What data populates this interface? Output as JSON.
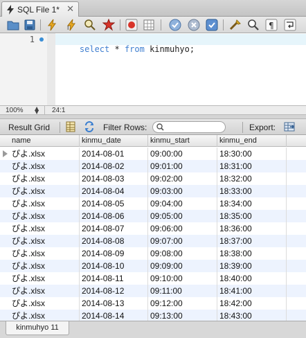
{
  "tab": {
    "label": "SQL File 1*",
    "close_glyph": "✕",
    "icon": "lightning-icon"
  },
  "toolbar": {
    "icons": [
      "open-folder-icon",
      "save-icon",
      "execute-icon",
      "execute-current-icon",
      "explain-icon",
      "stop-icon",
      "toggle-error-stop-icon",
      "toggle-limit-icon",
      "commit-icon",
      "rollback-icon",
      "autocommit-icon",
      "beautify-icon",
      "find-icon",
      "invisible-chars-icon",
      "wrap-icon"
    ]
  },
  "editor": {
    "line_number": "1",
    "tokens": [
      {
        "text": "select",
        "kind": "kw"
      },
      {
        "text": " * ",
        "kind": "plain"
      },
      {
        "text": "from",
        "kind": "kw"
      },
      {
        "text": " kinmuhyo;",
        "kind": "plain"
      }
    ]
  },
  "status": {
    "zoom": "100%",
    "cursor": "24:1"
  },
  "result_toolbar": {
    "result_grid_label": "Result Grid",
    "filter_label": "Filter Rows:",
    "filter_value": "",
    "export_label": "Export:"
  },
  "grid": {
    "columns": [
      "name",
      "kinmu_date",
      "kinmu_start",
      "kinmu_end"
    ],
    "rows": [
      [
        "ぴよ.xlsx",
        "2014-08-01",
        "09:00:00",
        "18:30:00"
      ],
      [
        "ぴよ.xlsx",
        "2014-08-02",
        "09:01:00",
        "18:31:00"
      ],
      [
        "ぴよ.xlsx",
        "2014-08-03",
        "09:02:00",
        "18:32:00"
      ],
      [
        "ぴよ.xlsx",
        "2014-08-04",
        "09:03:00",
        "18:33:00"
      ],
      [
        "ぴよ.xlsx",
        "2014-08-05",
        "09:04:00",
        "18:34:00"
      ],
      [
        "ぴよ.xlsx",
        "2014-08-06",
        "09:05:00",
        "18:35:00"
      ],
      [
        "ぴよ.xlsx",
        "2014-08-07",
        "09:06:00",
        "18:36:00"
      ],
      [
        "ぴよ.xlsx",
        "2014-08-08",
        "09:07:00",
        "18:37:00"
      ],
      [
        "ぴよ.xlsx",
        "2014-08-09",
        "09:08:00",
        "18:38:00"
      ],
      [
        "ぴよ.xlsx",
        "2014-08-10",
        "09:09:00",
        "18:39:00"
      ],
      [
        "ぴよ.xlsx",
        "2014-08-11",
        "09:10:00",
        "18:40:00"
      ],
      [
        "ぴよ.xlsx",
        "2014-08-12",
        "09:11:00",
        "18:41:00"
      ],
      [
        "ぴよ.xlsx",
        "2014-08-13",
        "09:12:00",
        "18:42:00"
      ],
      [
        "ぴよ.xlsx",
        "2014-08-14",
        "09:13:00",
        "18:43:00"
      ]
    ]
  },
  "result_tab": {
    "label": "kinmuhyo 11"
  }
}
